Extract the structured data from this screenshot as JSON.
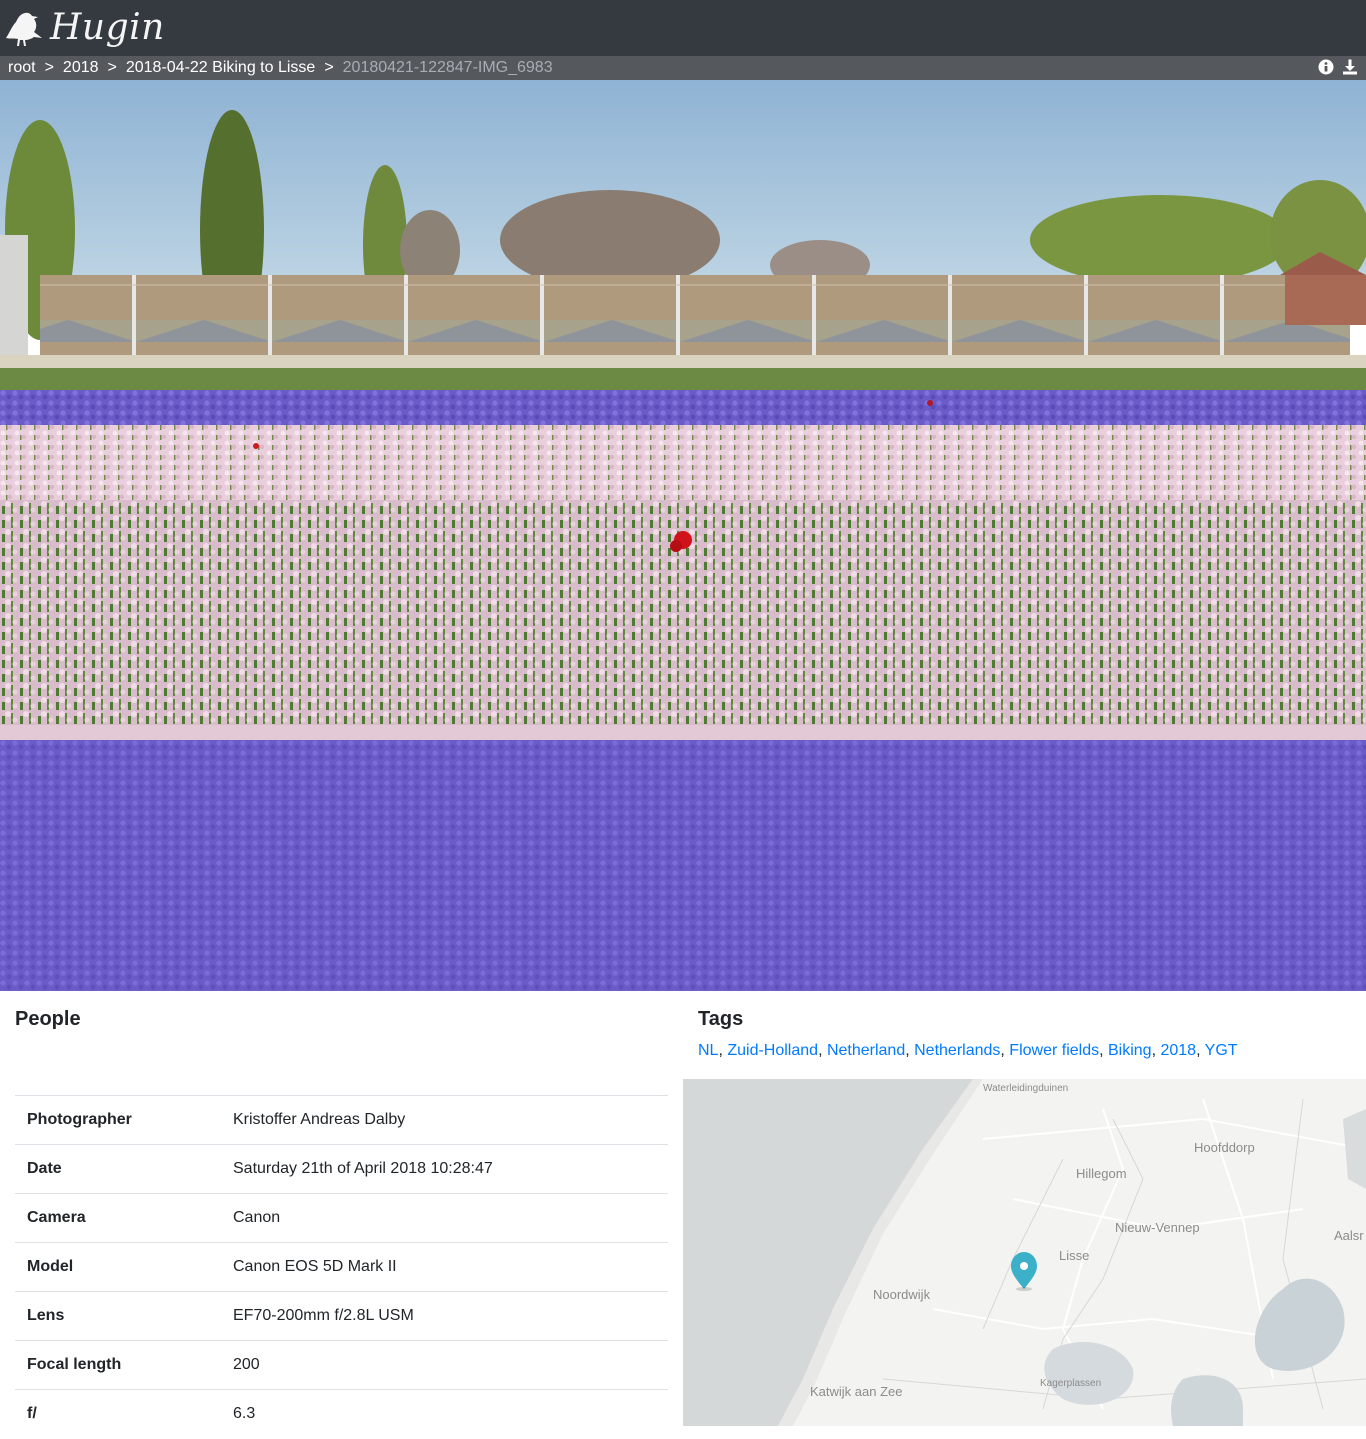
{
  "app": {
    "name": "Hugin"
  },
  "breadcrumb": {
    "items": [
      "root",
      "2018",
      "2018-04-22 Biking to Lisse"
    ],
    "separator": ">",
    "current": "20180421-122847-IMG_6983"
  },
  "icons": {
    "info": "info-circle-icon",
    "download": "download-icon",
    "marker": "map-marker-icon"
  },
  "people": {
    "title": "People"
  },
  "tags": {
    "title": "Tags",
    "items": [
      "NL",
      "Zuid-Holland",
      "Netherland",
      "Netherlands",
      "Flower fields",
      "Biking",
      "2018",
      "YGT"
    ]
  },
  "metadata": [
    {
      "key": "Photographer",
      "value": "Kristoffer Andreas Dalby"
    },
    {
      "key": "Date",
      "value": "Saturday 21th of April 2018 10:28:47"
    },
    {
      "key": "Camera",
      "value": "Canon"
    },
    {
      "key": "Model",
      "value": "Canon EOS 5D Mark II"
    },
    {
      "key": "Lens",
      "value": "EF70-200mm f/2.8L USM"
    },
    {
      "key": "Focal length",
      "value": "200"
    },
    {
      "key": "f/",
      "value": "6.3"
    }
  ],
  "map": {
    "places": [
      "Waterleidingduinen",
      "Hoofddorp",
      "Hillegom",
      "Nieuw-Vennep",
      "Lisse",
      "Aalsr",
      "Noordwijk",
      "Katwijk aan Zee",
      "Kagerplassen"
    ]
  },
  "colors": {
    "topbar": "#343a40",
    "crumbbar": "#55595e",
    "link": "#007bff",
    "marker": "#3cb0c9"
  }
}
